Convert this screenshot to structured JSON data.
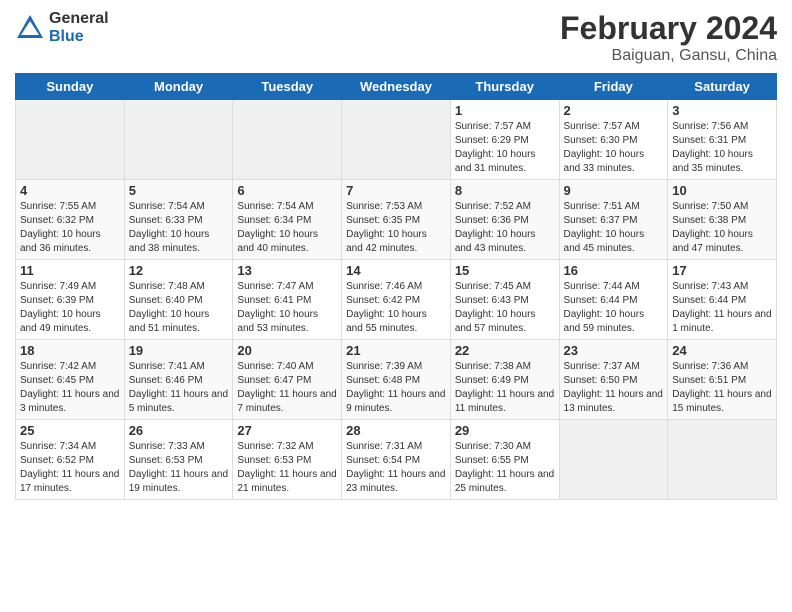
{
  "header": {
    "logo": {
      "general": "General",
      "blue": "Blue"
    },
    "title": "February 2024",
    "location": "Baiguan, Gansu, China"
  },
  "weekdays": [
    "Sunday",
    "Monday",
    "Tuesday",
    "Wednesday",
    "Thursday",
    "Friday",
    "Saturday"
  ],
  "weeks": [
    [
      {
        "day": "",
        "empty": true
      },
      {
        "day": "",
        "empty": true
      },
      {
        "day": "",
        "empty": true
      },
      {
        "day": "",
        "empty": true
      },
      {
        "day": "1",
        "sunrise": "7:57 AM",
        "sunset": "6:29 PM",
        "daylight": "10 hours and 31 minutes."
      },
      {
        "day": "2",
        "sunrise": "7:57 AM",
        "sunset": "6:30 PM",
        "daylight": "10 hours and 33 minutes."
      },
      {
        "day": "3",
        "sunrise": "7:56 AM",
        "sunset": "6:31 PM",
        "daylight": "10 hours and 35 minutes."
      }
    ],
    [
      {
        "day": "4",
        "sunrise": "7:55 AM",
        "sunset": "6:32 PM",
        "daylight": "10 hours and 36 minutes."
      },
      {
        "day": "5",
        "sunrise": "7:54 AM",
        "sunset": "6:33 PM",
        "daylight": "10 hours and 38 minutes."
      },
      {
        "day": "6",
        "sunrise": "7:54 AM",
        "sunset": "6:34 PM",
        "daylight": "10 hours and 40 minutes."
      },
      {
        "day": "7",
        "sunrise": "7:53 AM",
        "sunset": "6:35 PM",
        "daylight": "10 hours and 42 minutes."
      },
      {
        "day": "8",
        "sunrise": "7:52 AM",
        "sunset": "6:36 PM",
        "daylight": "10 hours and 43 minutes."
      },
      {
        "day": "9",
        "sunrise": "7:51 AM",
        "sunset": "6:37 PM",
        "daylight": "10 hours and 45 minutes."
      },
      {
        "day": "10",
        "sunrise": "7:50 AM",
        "sunset": "6:38 PM",
        "daylight": "10 hours and 47 minutes."
      }
    ],
    [
      {
        "day": "11",
        "sunrise": "7:49 AM",
        "sunset": "6:39 PM",
        "daylight": "10 hours and 49 minutes."
      },
      {
        "day": "12",
        "sunrise": "7:48 AM",
        "sunset": "6:40 PM",
        "daylight": "10 hours and 51 minutes."
      },
      {
        "day": "13",
        "sunrise": "7:47 AM",
        "sunset": "6:41 PM",
        "daylight": "10 hours and 53 minutes."
      },
      {
        "day": "14",
        "sunrise": "7:46 AM",
        "sunset": "6:42 PM",
        "daylight": "10 hours and 55 minutes."
      },
      {
        "day": "15",
        "sunrise": "7:45 AM",
        "sunset": "6:43 PM",
        "daylight": "10 hours and 57 minutes."
      },
      {
        "day": "16",
        "sunrise": "7:44 AM",
        "sunset": "6:44 PM",
        "daylight": "10 hours and 59 minutes."
      },
      {
        "day": "17",
        "sunrise": "7:43 AM",
        "sunset": "6:44 PM",
        "daylight": "11 hours and 1 minute."
      }
    ],
    [
      {
        "day": "18",
        "sunrise": "7:42 AM",
        "sunset": "6:45 PM",
        "daylight": "11 hours and 3 minutes."
      },
      {
        "day": "19",
        "sunrise": "7:41 AM",
        "sunset": "6:46 PM",
        "daylight": "11 hours and 5 minutes."
      },
      {
        "day": "20",
        "sunrise": "7:40 AM",
        "sunset": "6:47 PM",
        "daylight": "11 hours and 7 minutes."
      },
      {
        "day": "21",
        "sunrise": "7:39 AM",
        "sunset": "6:48 PM",
        "daylight": "11 hours and 9 minutes."
      },
      {
        "day": "22",
        "sunrise": "7:38 AM",
        "sunset": "6:49 PM",
        "daylight": "11 hours and 11 minutes."
      },
      {
        "day": "23",
        "sunrise": "7:37 AM",
        "sunset": "6:50 PM",
        "daylight": "11 hours and 13 minutes."
      },
      {
        "day": "24",
        "sunrise": "7:36 AM",
        "sunset": "6:51 PM",
        "daylight": "11 hours and 15 minutes."
      }
    ],
    [
      {
        "day": "25",
        "sunrise": "7:34 AM",
        "sunset": "6:52 PM",
        "daylight": "11 hours and 17 minutes."
      },
      {
        "day": "26",
        "sunrise": "7:33 AM",
        "sunset": "6:53 PM",
        "daylight": "11 hours and 19 minutes."
      },
      {
        "day": "27",
        "sunrise": "7:32 AM",
        "sunset": "6:53 PM",
        "daylight": "11 hours and 21 minutes."
      },
      {
        "day": "28",
        "sunrise": "7:31 AM",
        "sunset": "6:54 PM",
        "daylight": "11 hours and 23 minutes."
      },
      {
        "day": "29",
        "sunrise": "7:30 AM",
        "sunset": "6:55 PM",
        "daylight": "11 hours and 25 minutes."
      },
      {
        "day": "",
        "empty": true
      },
      {
        "day": "",
        "empty": true
      }
    ]
  ]
}
